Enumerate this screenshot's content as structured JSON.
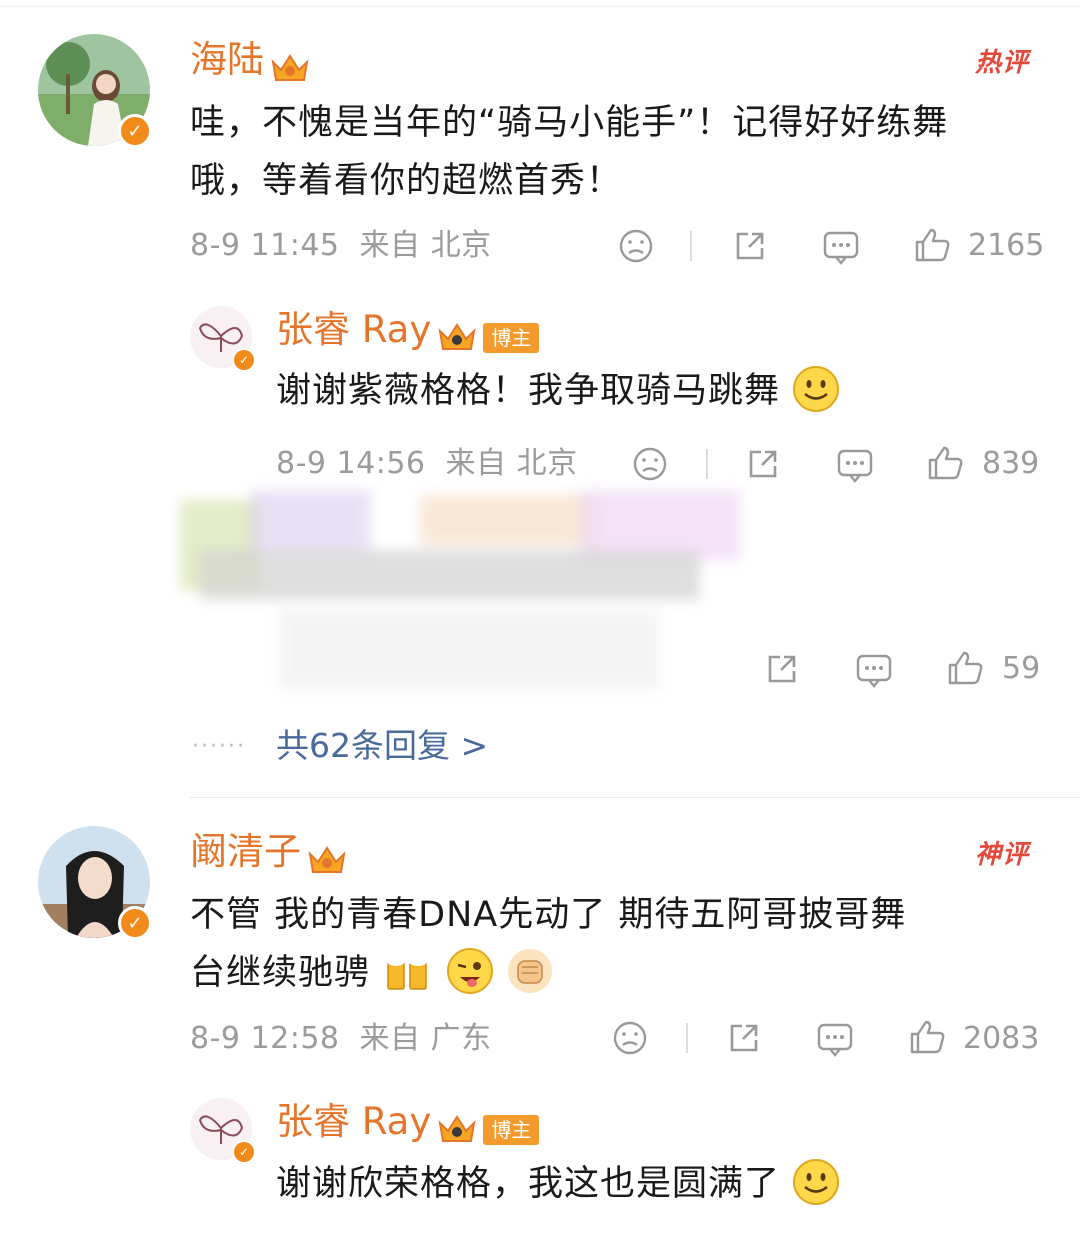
{
  "comments": [
    {
      "name": "海陆",
      "tag": "热评",
      "text_line1": "哇，不愧是当年的“骑马小能手”！记得好好练舞",
      "text_line2": "哦，等着看你的超燃首秀！",
      "time": "8-9 11:45",
      "source": "来自 北京",
      "likes": "2165",
      "reply": {
        "name": "张睿 Ray",
        "blogger_label": "博主",
        "text": "谢谢紫薇格格！我争取骑马跳舞",
        "time": "8-9 14:56",
        "source": "来自 北京",
        "likes": "839"
      },
      "hidden_reply_likes": "59",
      "more_replies": "共62条回复 >"
    },
    {
      "name": "阚清子",
      "tag": "神评",
      "text_line1": "不管 我的青春DNA先动了 期待五阿哥披哥舞",
      "text_line2": "台继续驰骋",
      "time": "8-9 12:58",
      "source": "来自 广东",
      "likes": "2083",
      "reply": {
        "name": "张睿 Ray",
        "blogger_label": "博主",
        "text": "谢谢欣荣格格，我这也是圆满了"
      }
    }
  ],
  "icons": [
    "dislike-icon",
    "share-icon",
    "comment-icon",
    "like-icon",
    "crown-icon",
    "verified-badge-icon",
    "smile-emoji",
    "beer-emoji",
    "wink-emoji",
    "fist-emoji"
  ],
  "colors": {
    "name": "#e5752b",
    "badge": "#f08a1a",
    "meta": "#9b9b9b",
    "link": "#4a6a9b",
    "hot": "#e24a3b"
  }
}
